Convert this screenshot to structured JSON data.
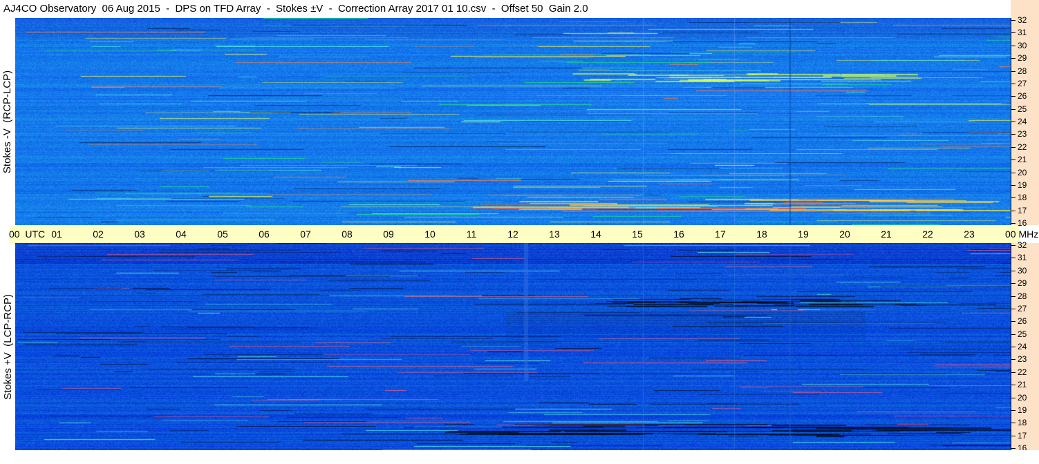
{
  "title": "AJ4CO Observatory  06 Aug 2015  -  DPS on TFD Array  -  Stokes ±V  -  Correction Array 2017 01 10.csv  -  Offset 50  Gain 2.0",
  "panels": {
    "top_label": "Stokes -V  (RCP-LCP)",
    "bottom_label": "Stokes +V  (LCP-RCP)"
  },
  "time_axis": {
    "ticks": [
      "00  UTC",
      "01",
      "02",
      "03",
      "04",
      "05",
      "06",
      "07",
      "08",
      "09",
      "10",
      "11",
      "12",
      "13",
      "14",
      "15",
      "16",
      "17",
      "18",
      "19",
      "20",
      "21",
      "22",
      "23",
      "00 MHz"
    ]
  },
  "freq_axis": {
    "labels": [
      "32",
      "31",
      "30",
      "29",
      "28",
      "27",
      "26",
      "25",
      "24",
      "23",
      "22",
      "21",
      "20",
      "19",
      "18",
      "17",
      "16"
    ]
  }
}
